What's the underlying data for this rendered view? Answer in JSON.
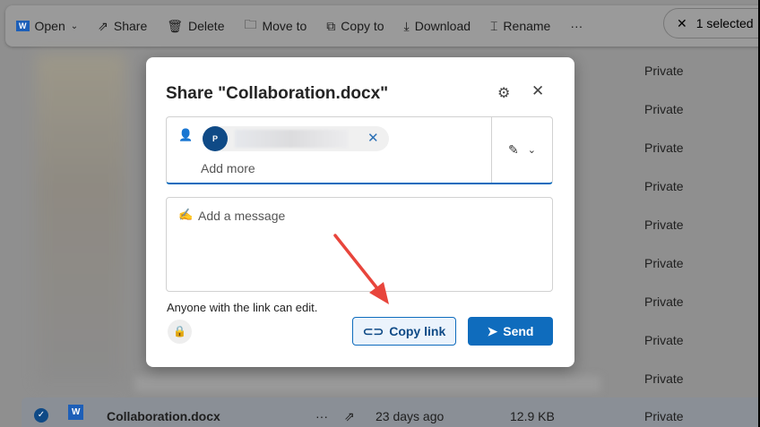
{
  "toolbar": {
    "open": "Open",
    "share": "Share",
    "delete": "Delete",
    "move_to": "Move to",
    "copy_to": "Copy to",
    "download": "Download",
    "rename": "Rename",
    "more": "···",
    "selected": "1 selected"
  },
  "rows": {
    "sharing": "Private"
  },
  "selected_file": {
    "name": "Collaboration.docx",
    "modified": "23 days ago",
    "size": "12.9 KB",
    "sharing": "Private",
    "more": "···"
  },
  "dialog": {
    "title": "Share \"Collaboration.docx\"",
    "recipient_initial": "P",
    "add_more": "Add more",
    "message_placeholder": "Add a message",
    "link_info": "Anyone with the link can edit.",
    "copy_link": "Copy link",
    "send": "Send"
  },
  "colors": {
    "accent": "#0f6cbd",
    "annotation": "#e8453c"
  }
}
